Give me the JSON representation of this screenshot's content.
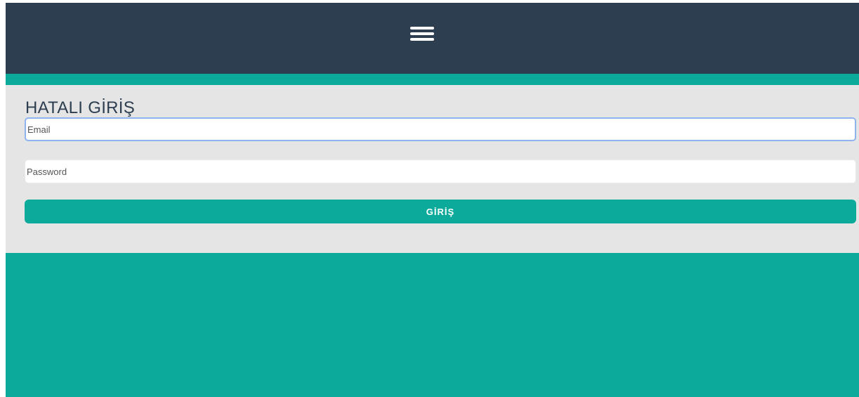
{
  "header": {
    "menu_icon": "hamburger-menu-icon"
  },
  "login": {
    "title": "HATALI GİRİŞ",
    "email_placeholder": "Email",
    "email_value": "",
    "password_placeholder": "Password",
    "password_value": "",
    "submit_label": "GİRİŞ"
  },
  "colors": {
    "header_bg": "#2d3e50",
    "accent": "#0caa9b",
    "panel_bg": "#e5e5e5",
    "focus_border": "#8fb4ec"
  }
}
